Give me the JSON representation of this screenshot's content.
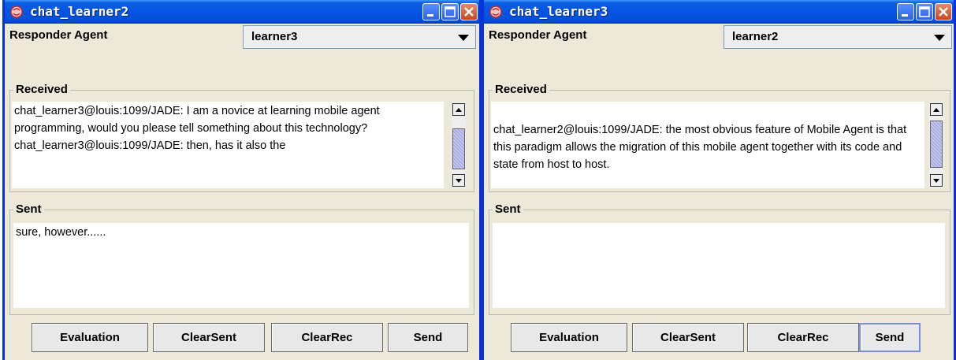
{
  "colors": {
    "titlebar": "#0554e3",
    "frame": "#0831d9",
    "window_bg": "#ece9d8"
  },
  "left": {
    "title": "chat_learner2",
    "responder_label": "Responder Agent",
    "responder_value": "learner3",
    "received_label": "Received",
    "received_text": "chat_learner3@louis:1099/JADE: I am a novice at learning mobile agent programming, would you please tell something about this technology?\nchat_learner3@louis:1099/JADE: then, has it also the",
    "sent_label": "Sent",
    "sent_text": "sure, however......",
    "buttons": [
      "Evaluation",
      "ClearSent",
      "ClearRec",
      "Send"
    ]
  },
  "right": {
    "title": "chat_learner3",
    "responder_label": "Responder Agent",
    "responder_value": "learner2",
    "received_label": "Received",
    "received_text": "chat_learner2@louis:1099/JADE: the most obvious feature of Mobile Agent is that this paradigm allows the migration of this mobile agent together with its code and state from host to host.",
    "sent_label": "Sent",
    "sent_text": "",
    "buttons": [
      "Evaluation",
      "ClearSent",
      "ClearRec",
      "Send"
    ]
  },
  "icons": [
    "app-icon",
    "minimize-icon",
    "maximize-icon",
    "close-icon",
    "dropdown-arrow-icon",
    "scroll-up-icon",
    "scroll-down-icon"
  ]
}
